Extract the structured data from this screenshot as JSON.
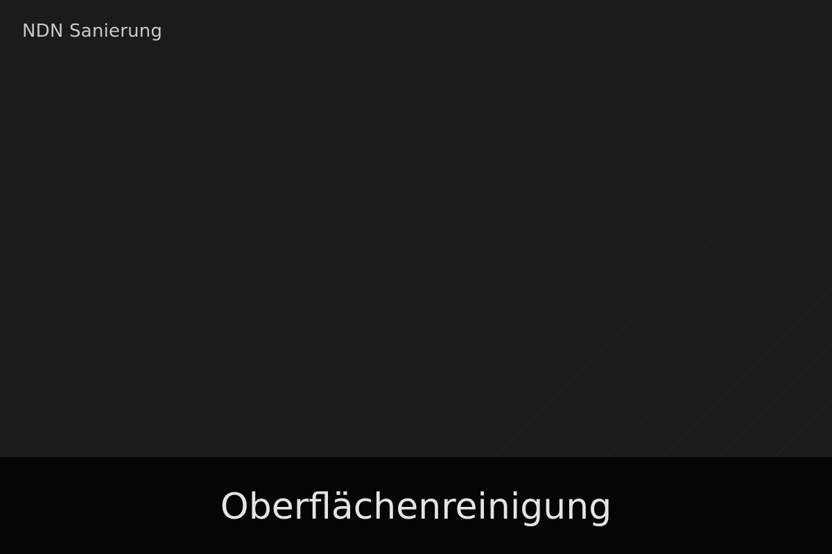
{
  "brand": {
    "name": "NDN Sanierung"
  },
  "caption": {
    "text": "Oberflächenreinigung"
  },
  "colors": {
    "background": "#1b1b1b",
    "caption_bar": "#050505",
    "brand_text": "#c9c9c9",
    "caption_text": "#e4e4e4"
  }
}
